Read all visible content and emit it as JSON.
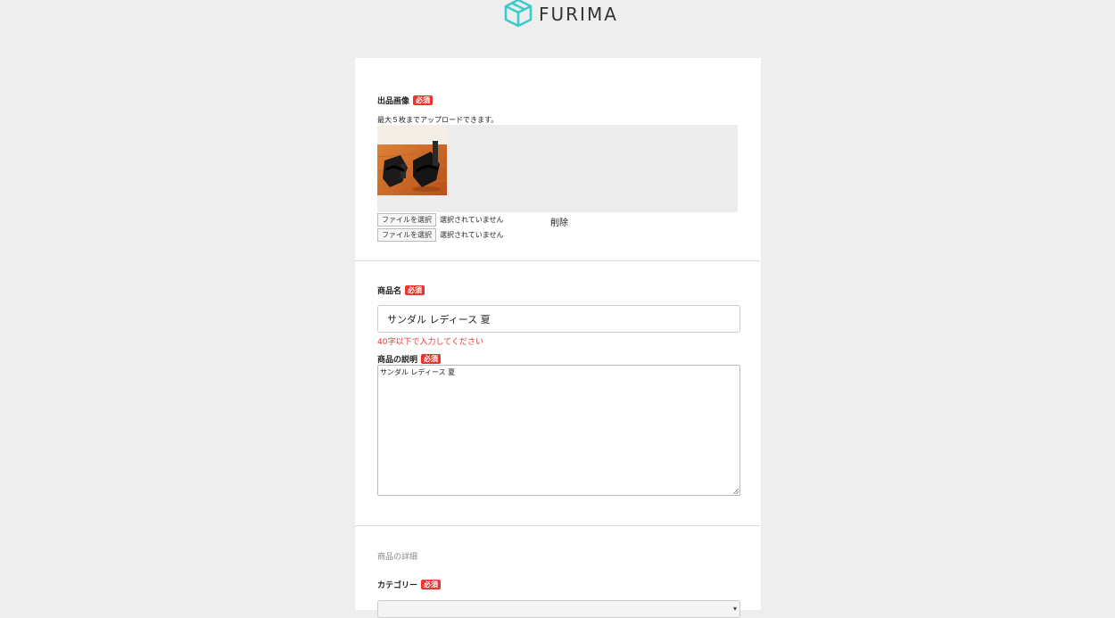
{
  "header": {
    "logo_icon": "box-logo-icon",
    "logo_text": "FURIMA",
    "brand_color": "#3ccace"
  },
  "images_section": {
    "label": "出品画像",
    "required_badge": "必須",
    "note": "最大５枚までアップロードできます。",
    "thumbnail": "sandal-photo",
    "file_inputs": [
      {
        "button": "ファイルを選択",
        "status": "選択されていません"
      },
      {
        "button": "ファイルを選択",
        "status": "選択されていません"
      }
    ],
    "delete_label": "削除"
  },
  "name_section": {
    "label": "商品名",
    "required_badge": "必須",
    "value": "サンダル レディース 夏",
    "error": "40字以下で入力してください"
  },
  "description_section": {
    "label": "商品の説明",
    "required_badge": "必須",
    "value": "サンダル レディース 夏"
  },
  "details_section": {
    "title": "商品の詳細",
    "category_label": "カテゴリー",
    "required_badge": "必須"
  },
  "colors": {
    "required_red": "#ea352d",
    "page_bg": "#eeeeee"
  }
}
